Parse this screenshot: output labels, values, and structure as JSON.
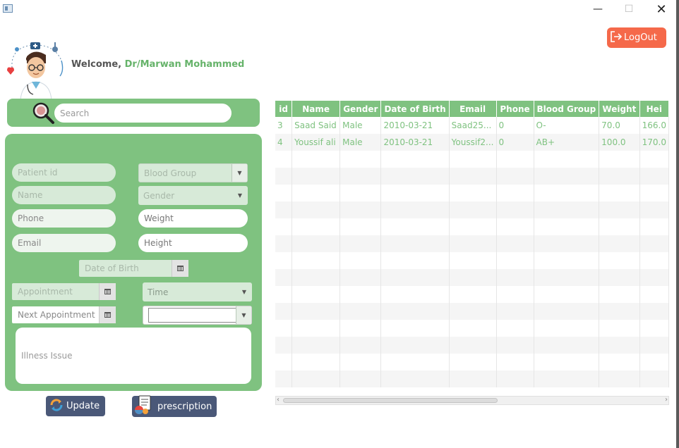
{
  "window": {
    "minimize": "—",
    "maximize": "☐",
    "close": "✕"
  },
  "header": {
    "welcome_label": "Welcome,",
    "doctor_name": "Dr/Marwan Mohammed",
    "logout_label": "LogOut"
  },
  "search": {
    "placeholder": "Search"
  },
  "form": {
    "patient_id": "Patient id",
    "blood_group": "Blood Group",
    "name": "Name",
    "gender": "Gender",
    "phone": "Phone",
    "weight": "Weight",
    "email": "Email",
    "height": "Height",
    "date_of_birth": "Date of Birth",
    "appointment": "Appointment",
    "time": "Time",
    "next_appointment": "Next Appointment",
    "next_time_value": "",
    "illness_issue": "Illness Issue"
  },
  "buttons": {
    "update": "Update",
    "prescription": "prescription"
  },
  "table": {
    "columns": [
      "id",
      "Name",
      "Gender",
      "Date of Birth",
      "Email",
      "Phone",
      "Blood Group",
      "Weight",
      "Hei"
    ],
    "rows": [
      [
        "3",
        "Saad Said",
        "Male",
        "2010-03-21",
        "Saad25...",
        "0",
        "O-",
        "70.0",
        "166.0"
      ],
      [
        "4",
        "Youssif ali",
        "Male",
        "2010-03-21",
        "Youssif2...",
        "0",
        "AB+",
        "100.0",
        "170.0"
      ]
    ]
  },
  "colors": {
    "accent": "#7fc280",
    "logout": "#f5694a",
    "button_dark": "#4a5878"
  },
  "icons": {
    "search": "magnifier-icon",
    "logout": "logout-icon",
    "avatar": "doctor-avatar",
    "update": "refresh-icon",
    "prescription": "prescription-icon"
  }
}
